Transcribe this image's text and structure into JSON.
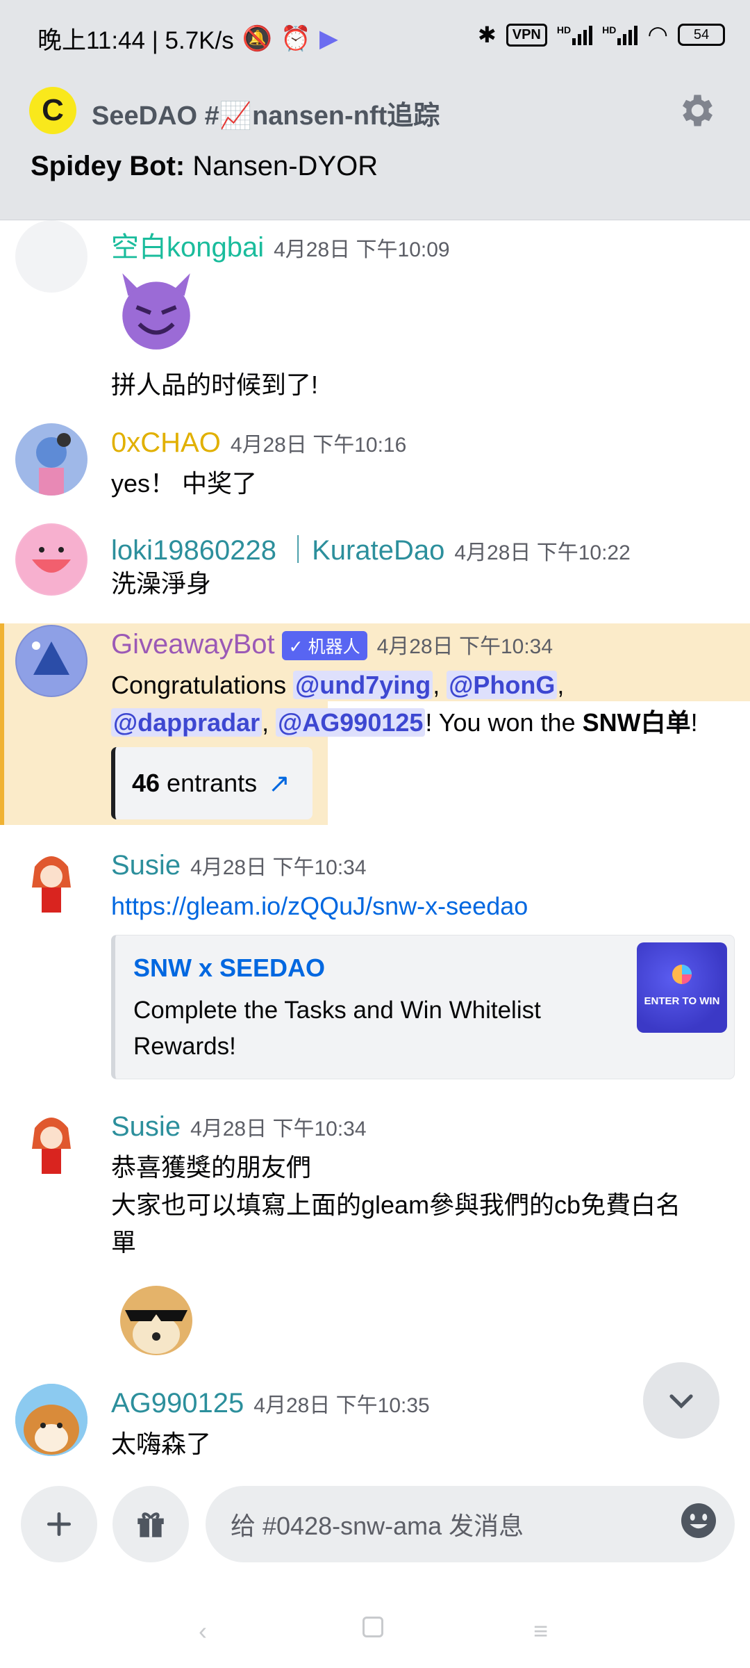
{
  "status_bar": {
    "time": "晚上11:44 | 5.7K/s",
    "vpn": "VPN",
    "battery": "54",
    "hd1": "HD",
    "hd2": "HD"
  },
  "header": {
    "server_name": "SeeDAO",
    "channel": "#📈nansen-nft追踪",
    "topic_author": "Spidey Bot:",
    "topic_text": "Nansen-DYOR"
  },
  "messages": [
    {
      "user": "空白kongbai",
      "time": "4月28日 下午10:09",
      "text": "拼人品的时候到了!",
      "color": "#1abc9c"
    },
    {
      "user": "0xCHAO",
      "time": "4月28日 下午10:16",
      "text": "yes！ 中奖了",
      "color": "#e1b000"
    },
    {
      "user": "loki19860228 ｜KurateDao",
      "time": "4月28日 下午10:22",
      "text": "洗澡淨身",
      "color": "#2c8f9c"
    },
    {
      "user": "GiveawayBot",
      "bot_tag": "✓ 机器人",
      "time": "4月28日 下午10:34",
      "color": "#9b59b6",
      "text_prefix": "Congratulations ",
      "mentions": [
        "@und7ying",
        "@PhonG",
        "@dappradar",
        "@AG990125"
      ],
      "text_mid": "! You won the ",
      "prize": "SNW白单",
      "text_end": "!",
      "entrants_num": "46",
      "entrants_label": "entrants"
    },
    {
      "user": "Susie",
      "time": "4月28日 下午10:34",
      "color": "#2c8f9c",
      "link": "https://gleam.io/zQQuJ/snw-x-seedao",
      "embed_title": "SNW x SEEDAO",
      "embed_desc": "Complete the Tasks and Win Whitelist Rewards!",
      "embed_thumb_text": "ENTER TO WIN"
    },
    {
      "user": "Susie",
      "time": "4月28日 下午10:34",
      "color": "#2c8f9c",
      "line1": "恭喜獲獎的朋友們",
      "line2": "大家也可以填寫上面的gleam參與我們的cb免費白名",
      "line3": "單"
    },
    {
      "user": "AG990125",
      "time": "4月28日 下午10:35",
      "text": "太嗨森了",
      "color": "#2c8f9c"
    }
  ],
  "composer": {
    "placeholder": "给 #0428-snw-ama 发消息"
  },
  "colors": {
    "mention_bg": "#dee0fc",
    "mention_fg": "#3d47d1",
    "highlight": "#fbebc9",
    "highlight_bar": "#f0b232",
    "link": "#0067e0"
  }
}
